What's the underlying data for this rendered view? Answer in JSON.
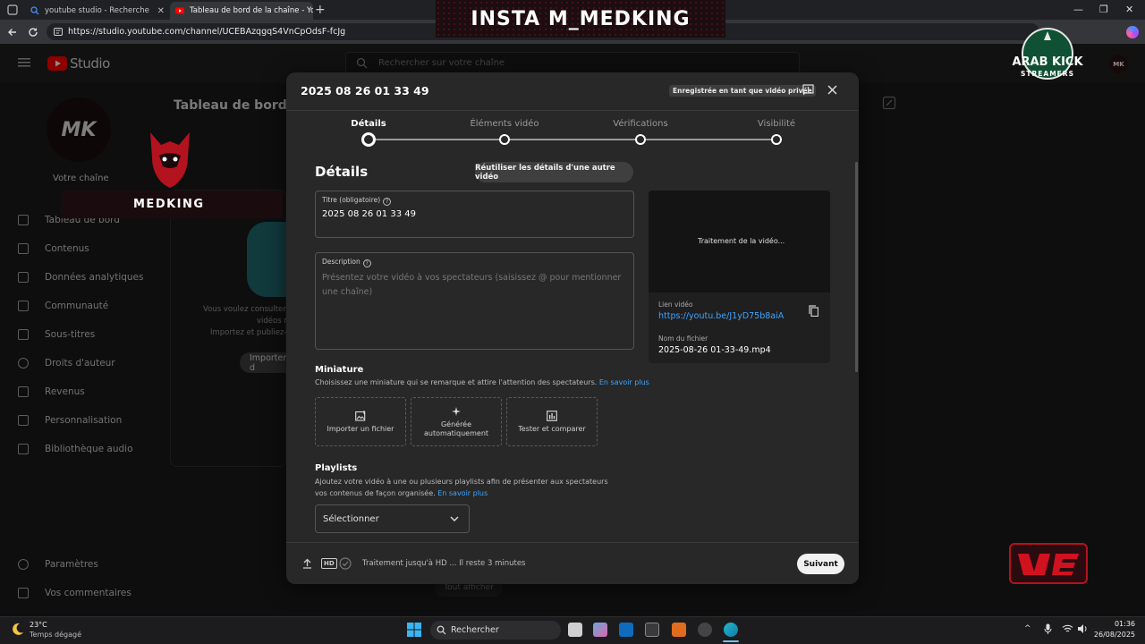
{
  "browser": {
    "tabs": [
      {
        "label": "youtube studio - Recherche"
      },
      {
        "label": "Tableau de bord de la chaîne - Yo"
      }
    ],
    "url": "https://studio.youtube.com/channel/UCEBAzqgqS4VnCpOdsF-fcJg"
  },
  "studio": {
    "logo": "Studio",
    "search_placeholder": "Rechercher sur votre chaîne",
    "page_title": "Tableau de bord d",
    "channel_label": "Votre chaîne",
    "avatar_text": "MK",
    "sidebar": [
      {
        "label": "Tableau de bord",
        "icon": "dashboard-icon"
      },
      {
        "label": "Contenus",
        "icon": "content-icon"
      },
      {
        "label": "Données analytiques",
        "icon": "analytics-icon"
      },
      {
        "label": "Communauté",
        "icon": "community-icon"
      },
      {
        "label": "Sous-titres",
        "icon": "subtitles-icon"
      },
      {
        "label": "Droits d'auteur",
        "icon": "copyright-icon"
      },
      {
        "label": "Revenus",
        "icon": "revenue-icon"
      },
      {
        "label": "Personnalisation",
        "icon": "customization-icon"
      },
      {
        "label": "Bibliothèque audio",
        "icon": "audio-library-icon"
      }
    ],
    "sidebar_bottom": [
      {
        "label": "Paramètres",
        "icon": "settings-icon"
      },
      {
        "label": "Vos commentaires",
        "icon": "feedback-icon"
      }
    ],
    "card_text_1": "Vous voulez consulter le",
    "card_text_2": "vidéos r",
    "card_text_3": "Importez et publiez-en",
    "import_button": "Importer d",
    "show_all": "Tout afficher"
  },
  "modal": {
    "title": "2025 08 26 01 33 49",
    "saved_badge": "Enregistrée en tant que vidéo privée",
    "steps": [
      {
        "label": "Détails",
        "active": true
      },
      {
        "label": "Éléments vidéo",
        "active": false
      },
      {
        "label": "Vérifications",
        "active": false
      },
      {
        "label": "Visibilité",
        "active": false
      }
    ],
    "section_title": "Détails",
    "reuse_button": "Réutiliser les détails d'une autre vidéo",
    "title_field": {
      "label": "Titre (obligatoire)",
      "value": "2025 08 26 01 33 49"
    },
    "description_field": {
      "label": "Description",
      "placeholder": "Présentez votre vidéo à vos spectateurs (saisissez @ pour mentionner une chaîne)"
    },
    "preview": {
      "processing": "Traitement de la vidéo...",
      "link_label": "Lien vidéo",
      "link": "https://youtu.be/J1yD75b8aiA",
      "filename_label": "Nom du fichier",
      "filename": "2025-08-26 01-33-49.mp4"
    },
    "thumbnail": {
      "title": "Miniature",
      "description": "Choisissez une miniature qui se remarque et attire l'attention des spectateurs.",
      "learn_more": "En savoir plus",
      "options": [
        {
          "label": "Importer un fichier",
          "icon": "image-upload-icon"
        },
        {
          "label": "Générée automatiquement",
          "icon": "sparkle-icon"
        },
        {
          "label": "Tester et comparer",
          "icon": "bar-chart-icon"
        }
      ]
    },
    "playlists": {
      "title": "Playlists",
      "description": "Ajoutez votre vidéo à une ou plusieurs playlists afin de présenter aux spectateurs vos contenus de façon organisée.",
      "learn_more": "En savoir plus",
      "select": "Sélectionner"
    },
    "footer": {
      "hd_badge": "HD",
      "status": "Traitement jusqu'à HD ... Il reste 3 minutes",
      "next_button": "Suivant"
    }
  },
  "overlays": {
    "insta": "INSTA  M_MEDKING",
    "medking": "MEDKING",
    "arabkick_line1": "ARAB KICK",
    "arabkick_line2": "STREAMERS"
  },
  "taskbar": {
    "temperature": "23°C",
    "weather": "Temps dégagé",
    "search": "Rechercher",
    "time": "01:36",
    "date": "26/08/2025"
  },
  "colors": {
    "accent_link": "#3ea6ff",
    "youtube_red": "#ff0000"
  }
}
